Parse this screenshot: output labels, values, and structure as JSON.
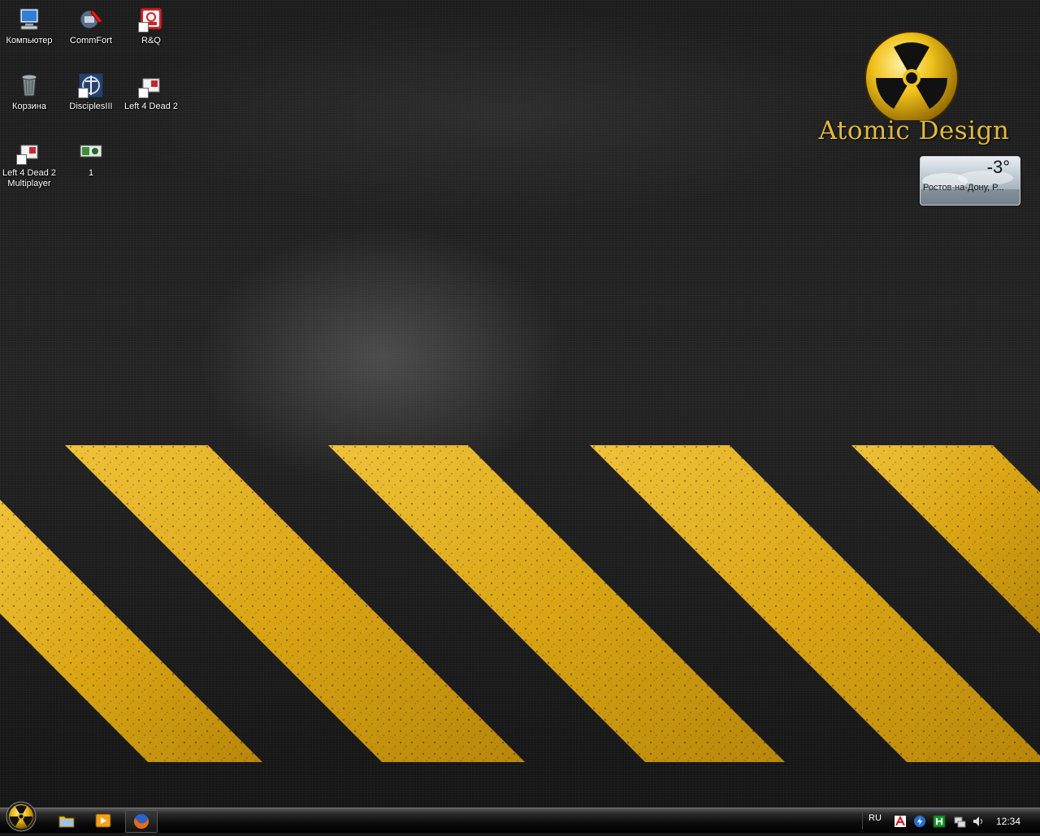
{
  "desktop": {
    "icons": [
      {
        "label": "Компьютер",
        "icon": "computer-icon"
      },
      {
        "label": "CommFort",
        "icon": "commfort-icon"
      },
      {
        "label": "R&Q",
        "icon": "rq-icon"
      },
      {
        "label": "Корзина",
        "icon": "recycle-bin-icon"
      },
      {
        "label": "DisciplesIII",
        "icon": "disciples-icon"
      },
      {
        "label": "Left 4 Dead 2",
        "icon": "shortcut-icon"
      },
      {
        "label": "Left 4 Dead 2 Multiplayer",
        "icon": "shortcut-icon"
      },
      {
        "label": "1",
        "icon": "image-file-icon"
      }
    ],
    "wallpaper_logo": "Atomic Design",
    "accent_color": "#e8b51e"
  },
  "weather_gadget": {
    "temperature": "-3°",
    "location": "Ростов-на-Дону, Р..."
  },
  "taskbar": {
    "start_button": "start-orb-radiation-icon",
    "quick_launch": [
      "explorer-folder-icon",
      "media-player-icon"
    ],
    "running_tasks": [
      "firefox-icon"
    ],
    "tray": {
      "language": "RU",
      "icons": [
        "antivirus-icon",
        "update-icon",
        "green-app-icon",
        "network-icon",
        "volume-icon"
      ],
      "clock": "12:34"
    }
  }
}
